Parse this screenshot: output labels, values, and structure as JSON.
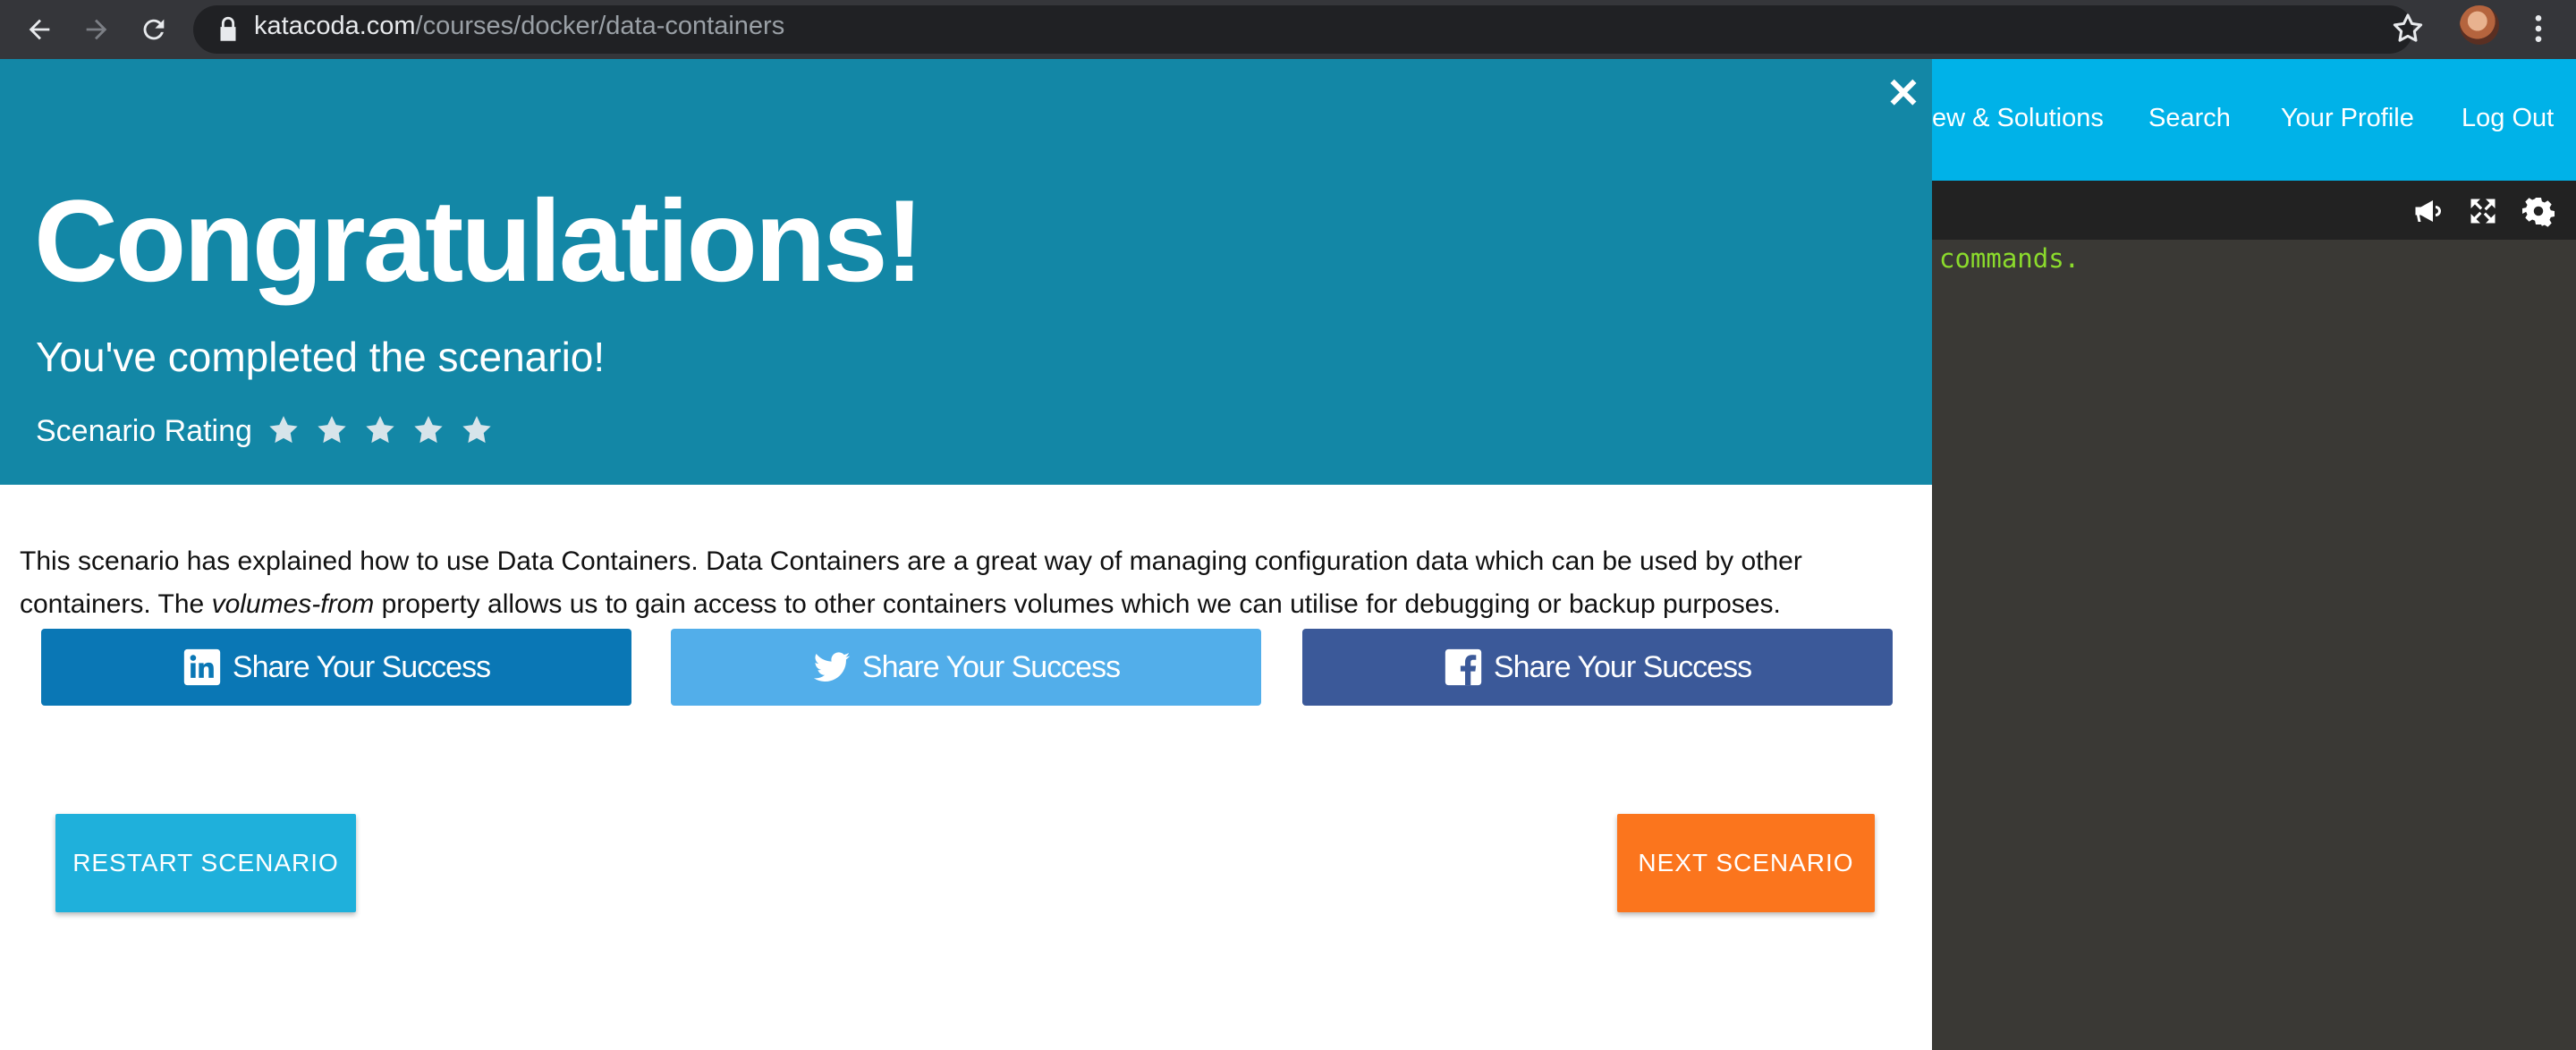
{
  "browser": {
    "url_host": "katacoda.com",
    "url_path": "/courses/docker/data-containers"
  },
  "site_nav": {
    "items": [
      "ew & Solutions",
      "Search",
      "Your Profile",
      "Log Out"
    ]
  },
  "terminal": {
    "visible_text": "commands."
  },
  "modal": {
    "title": "Congratulations!",
    "subtitle": "You've completed the scenario!",
    "rating_label": "Scenario Rating",
    "rating_stars": 5,
    "description_before": "This scenario has explained how to use Data Containers. Data Containers are a great way of managing configuration data which can be used by other containers. The ",
    "description_em": "volumes-from",
    "description_after": " property allows us to gain access to other containers volumes which we can utilise for debugging or backup purposes.",
    "share": {
      "linkedin_label": "Share Your Success",
      "twitter_label": "Share Your Success",
      "facebook_label": "Share Your Success"
    },
    "restart_label": "RESTART SCENARIO",
    "next_label": "NEXT SCENARIO"
  },
  "colors": {
    "header_bg": "#1387a6",
    "nav_bg": "#00b2e8",
    "linkedin": "#0a77b5",
    "twitter": "#52aeea",
    "facebook": "#3b5999",
    "restart": "#1fb0db",
    "next": "#fb751d",
    "terminal_text": "#8bdb2c"
  }
}
